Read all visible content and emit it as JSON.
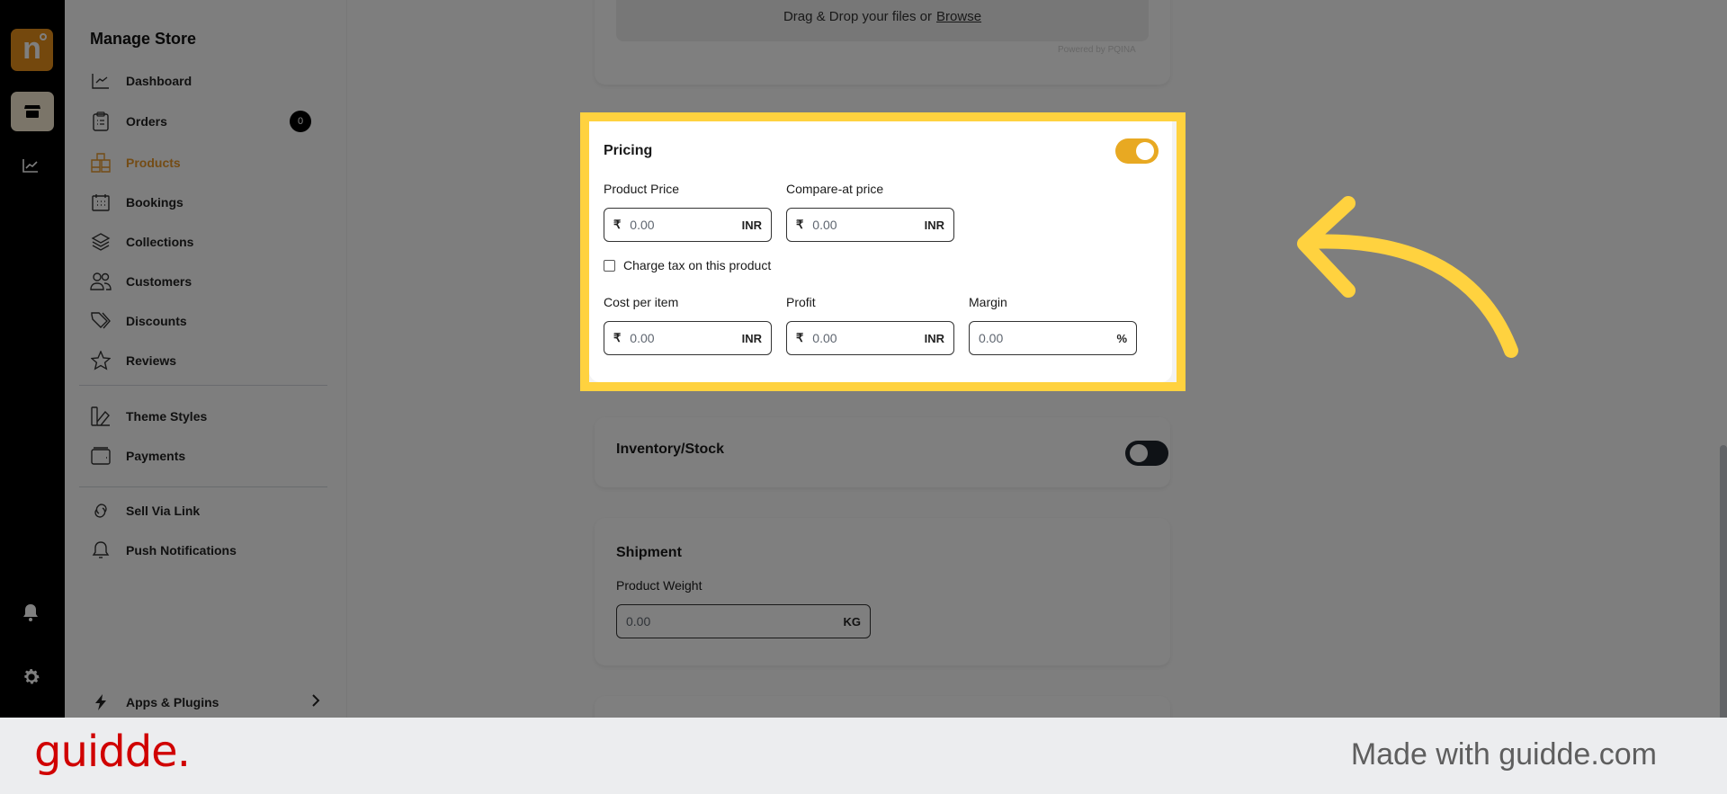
{
  "rail": {
    "logo_letter": "n",
    "items": [
      {
        "name": "store",
        "icon": "store-icon",
        "active": true
      },
      {
        "name": "analytics",
        "icon": "chart-line-icon",
        "active": false
      }
    ],
    "bottom": [
      {
        "name": "notifications",
        "icon": "bell-icon"
      },
      {
        "name": "settings",
        "icon": "gear-icon"
      }
    ]
  },
  "sidebar": {
    "title": "Manage Store",
    "items": [
      {
        "label": "Dashboard",
        "icon": "chart-line-icon"
      },
      {
        "label": "Orders",
        "icon": "clipboard-icon",
        "badge": "0"
      },
      {
        "label": "Products",
        "icon": "cubes-icon",
        "active": true
      },
      {
        "label": "Bookings",
        "icon": "calendar-icon"
      },
      {
        "label": "Collections",
        "icon": "layers-icon"
      },
      {
        "label": "Customers",
        "icon": "users-icon"
      },
      {
        "label": "Discounts",
        "icon": "tags-icon"
      },
      {
        "label": "Reviews",
        "icon": "star-icon"
      },
      {
        "label": "Theme Styles",
        "icon": "swatch-icon"
      },
      {
        "label": "Payments",
        "icon": "wallet-icon"
      },
      {
        "label": "Sell Via Link",
        "icon": "link-icon"
      },
      {
        "label": "Push Notifications",
        "icon": "bell-icon"
      }
    ],
    "apps": {
      "label": "Apps & Plugins",
      "icon": "bolt-icon"
    }
  },
  "media": {
    "dropzone_text": "Drag & Drop your files or",
    "browse_link": "Browse",
    "powered_by": "Powered by PQINA"
  },
  "pricing": {
    "title": "Pricing",
    "enabled": true,
    "product_price": {
      "label": "Product Price",
      "prefix": "₹",
      "value": "0.00",
      "suffix": "INR"
    },
    "compare_at_price": {
      "label": "Compare-at price",
      "prefix": "₹",
      "value": "0.00",
      "suffix": "INR"
    },
    "charge_tax": {
      "label": "Charge tax on this product",
      "checked": false
    },
    "cost_per_item": {
      "label": "Cost per item",
      "prefix": "₹",
      "value": "0.00",
      "suffix": "INR"
    },
    "profit": {
      "label": "Profit",
      "prefix": "₹",
      "value": "0.00",
      "suffix": "INR"
    },
    "margin": {
      "label": "Margin",
      "value": "0.00",
      "suffix": "%"
    }
  },
  "inventory": {
    "title": "Inventory/Stock",
    "enabled": false
  },
  "shipment": {
    "title": "Shipment",
    "weight": {
      "label": "Product Weight",
      "value": "0.00",
      "suffix": "KG"
    }
  },
  "colors": {
    "accent": "#e8a922",
    "highlight": "#ffd23f",
    "brand_red": "#d00000"
  },
  "footer": {
    "brand": "guidde.",
    "made_with": "Made with guidde.com"
  }
}
